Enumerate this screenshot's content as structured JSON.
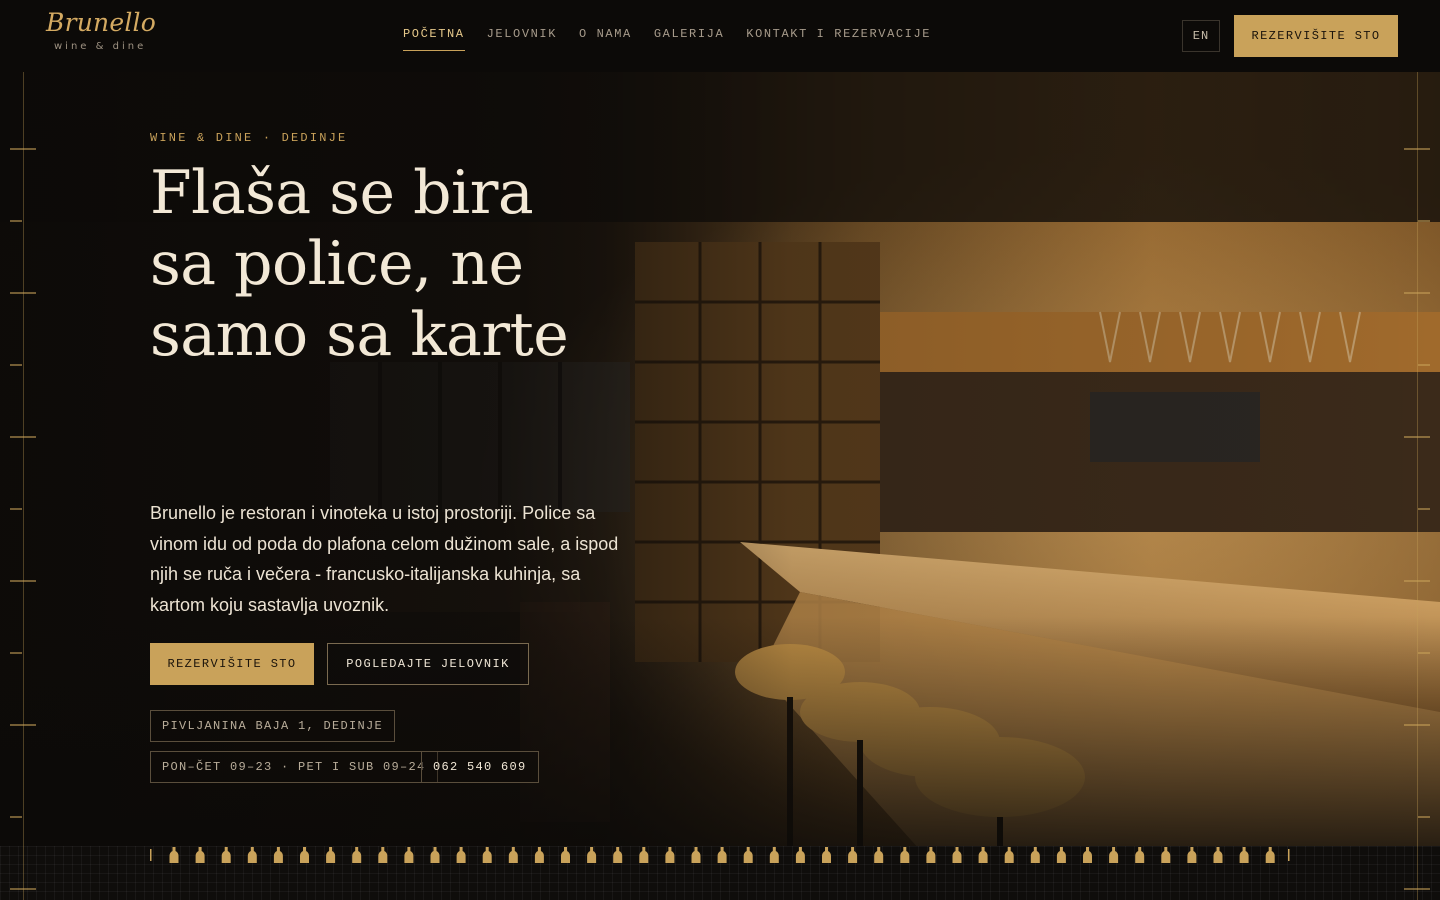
{
  "brand": {
    "name": "Brunello",
    "tagline": "wine & dine"
  },
  "nav": {
    "items": [
      {
        "label": "POČETNA",
        "active": true
      },
      {
        "label": "JELOVNIK",
        "active": false
      },
      {
        "label": "O NAMA",
        "active": false
      },
      {
        "label": "GALERIJA",
        "active": false
      },
      {
        "label": "KONTAKT I REZERVACIJE",
        "active": false
      }
    ],
    "language": "EN",
    "cta_label": "REZERVIŠITE STO"
  },
  "hero": {
    "eyebrow": "WINE & DINE · DEDINJE",
    "title_lines": [
      "Flaša se bira",
      "sa police, ne",
      "samo sa karte"
    ],
    "description": "Brunello je restoran i vinoteka u istoj prostoriji. Police sa vinom idu od poda do plafona celom dužinom sale, a ispod njih se ruča i večera - francusko-italijanska kuhinja, sa kartom koju sastavlja uvoznik.",
    "primary_button": "REZERVIŠITE STO",
    "secondary_button": "POGLEDAJTE JELOVNIK",
    "address": "PIVLJANINA BAJA 1, DEDINJE",
    "hours": "PON–ČET 09–23 · PET I SUB 09–24",
    "phone": "062 540 609"
  },
  "icons": {
    "decor": "bottle-icon"
  },
  "colors": {
    "accent": "#c9a25a",
    "background": "#0e0c0a",
    "text": "#efe6d6"
  }
}
